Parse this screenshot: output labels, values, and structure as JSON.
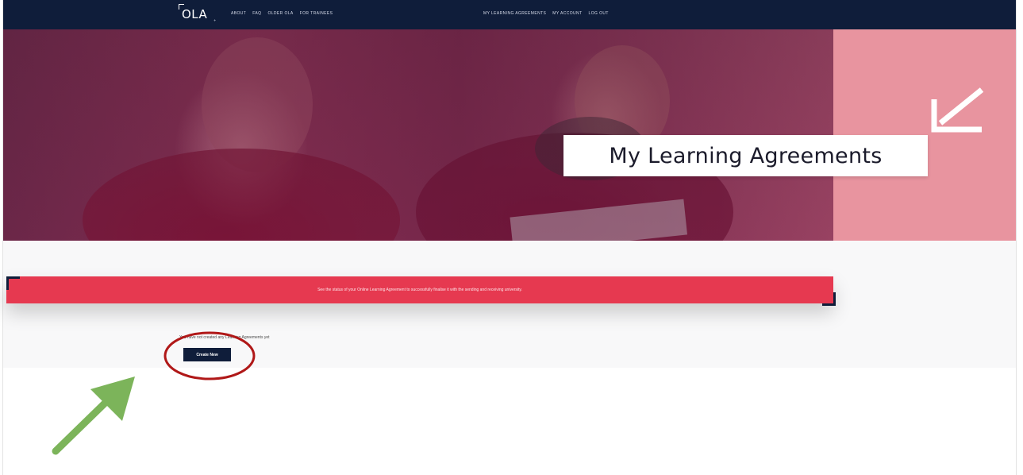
{
  "navbar": {
    "logo": "OLA",
    "logo_sub": "+",
    "left_links": [
      "About",
      "FAQ",
      "Older OLA",
      "For trainees"
    ],
    "right_links": [
      "My Learning Agreements",
      "My Account",
      "Log out"
    ]
  },
  "hero": {
    "title": "My Learning Agreements",
    "photo_icon": "students-photo",
    "corner_icon": "arrow-down-left-icon"
  },
  "banner": {
    "text": "See the status of your Online Learning Agreement to successfully finalise it with the sending and receiving university."
  },
  "main": {
    "empty_message": "You have not created any Learning Agreements yet",
    "create_button": "Create New"
  },
  "overlays": {
    "highlight": "red-circle-highlight",
    "pointer": "green-arrow-pointer"
  },
  "colors": {
    "navbar": "#0f1d3a",
    "banner": "#e63950",
    "hero_panel": "#e8949f",
    "highlight": "#b01818",
    "pointer": "#7cb45a",
    "button": "#0f1d3a"
  }
}
